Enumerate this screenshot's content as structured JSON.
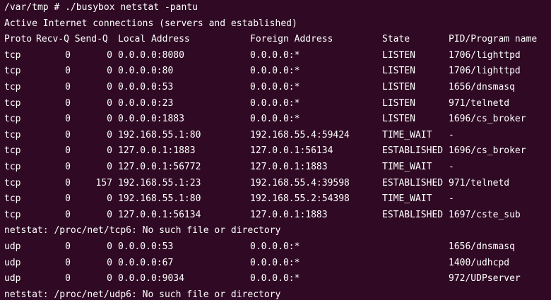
{
  "command_line": "/var/tmp # ./busybox netstat -pantu",
  "header_info": "Active Internet connections (servers and established)",
  "columns": {
    "proto": "Proto",
    "recv_send": "Recv-Q Send-Q",
    "local": "Local Address",
    "foreign": "Foreign Address",
    "state": "State",
    "pid": "PID/Program name"
  },
  "tcp_rows": [
    {
      "proto": "tcp",
      "recv": "0",
      "send": "0",
      "local": "0.0.0.0:8080",
      "foreign": "0.0.0.0:*",
      "state": "LISTEN",
      "pid": "1706/lighttpd"
    },
    {
      "proto": "tcp",
      "recv": "0",
      "send": "0",
      "local": "0.0.0.0:80",
      "foreign": "0.0.0.0:*",
      "state": "LISTEN",
      "pid": "1706/lighttpd"
    },
    {
      "proto": "tcp",
      "recv": "0",
      "send": "0",
      "local": "0.0.0.0:53",
      "foreign": "0.0.0.0:*",
      "state": "LISTEN",
      "pid": "1656/dnsmasq"
    },
    {
      "proto": "tcp",
      "recv": "0",
      "send": "0",
      "local": "0.0.0.0:23",
      "foreign": "0.0.0.0:*",
      "state": "LISTEN",
      "pid": "971/telnetd"
    },
    {
      "proto": "tcp",
      "recv": "0",
      "send": "0",
      "local": "0.0.0.0:1883",
      "foreign": "0.0.0.0:*",
      "state": "LISTEN",
      "pid": "1696/cs_broker"
    },
    {
      "proto": "tcp",
      "recv": "0",
      "send": "0",
      "local": "192.168.55.1:80",
      "foreign": "192.168.55.4:59424",
      "state": "TIME_WAIT",
      "pid": "-"
    },
    {
      "proto": "tcp",
      "recv": "0",
      "send": "0",
      "local": "127.0.0.1:1883",
      "foreign": "127.0.0.1:56134",
      "state": "ESTABLISHED",
      "pid": "1696/cs_broker"
    },
    {
      "proto": "tcp",
      "recv": "0",
      "send": "0",
      "local": "127.0.0.1:56772",
      "foreign": "127.0.0.1:1883",
      "state": "TIME_WAIT",
      "pid": "-"
    },
    {
      "proto": "tcp",
      "recv": "0",
      "send": "157",
      "local": "192.168.55.1:23",
      "foreign": "192.168.55.4:39598",
      "state": "ESTABLISHED",
      "pid": "971/telnetd"
    },
    {
      "proto": "tcp",
      "recv": "0",
      "send": "0",
      "local": "192.168.55.1:80",
      "foreign": "192.168.55.2:54398",
      "state": "TIME_WAIT",
      "pid": "-"
    },
    {
      "proto": "tcp",
      "recv": "0",
      "send": "0",
      "local": "127.0.0.1:56134",
      "foreign": "127.0.0.1:1883",
      "state": "ESTABLISHED",
      "pid": "1697/cste_sub"
    }
  ],
  "tcp6_error": "netstat: /proc/net/tcp6: No such file or directory",
  "udp_rows": [
    {
      "proto": "udp",
      "recv": "0",
      "send": "0",
      "local": "0.0.0.0:53",
      "foreign": "0.0.0.0:*",
      "state": "",
      "pid": "1656/dnsmasq"
    },
    {
      "proto": "udp",
      "recv": "0",
      "send": "0",
      "local": "0.0.0.0:67",
      "foreign": "0.0.0.0:*",
      "state": "",
      "pid": "1400/udhcpd"
    },
    {
      "proto": "udp",
      "recv": "0",
      "send": "0",
      "local": "0.0.0.0:9034",
      "foreign": "0.0.0.0:*",
      "state": "",
      "pid": "972/UDPserver"
    }
  ],
  "udp6_error": "netstat: /proc/net/udp6: No such file or directory"
}
